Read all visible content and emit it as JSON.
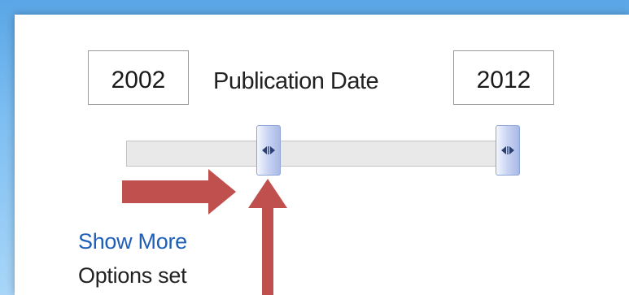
{
  "publication_date_filter": {
    "label": "Publication Date",
    "from_year": "2002",
    "to_year": "2012"
  },
  "slider": {
    "icons": {
      "handle": "horizontal-resize-grip-icon",
      "annotation": "red-arrow-icon"
    }
  },
  "links": {
    "show_more": "Show More"
  },
  "status": {
    "options_set": "Options set"
  },
  "colors": {
    "link": "#1f5fb6",
    "annotation_arrow": "#c0504d",
    "handle": "#a9b9e6"
  }
}
